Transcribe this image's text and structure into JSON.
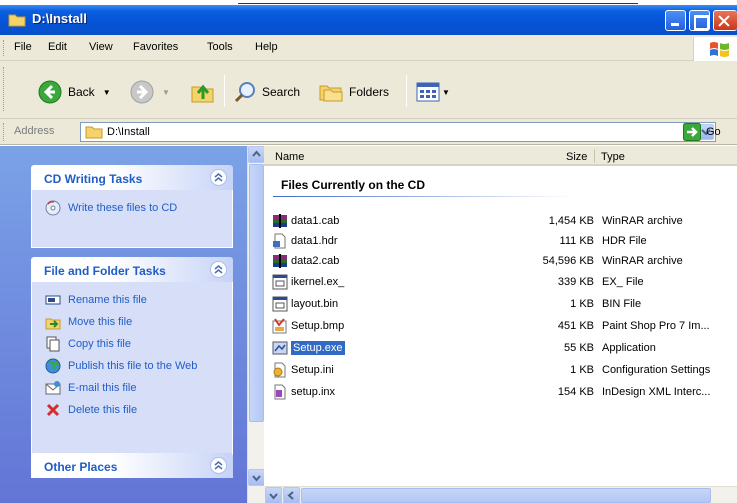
{
  "window": {
    "title": "D:\\Install"
  },
  "menu": [
    "File",
    "Edit",
    "View",
    "Favorites",
    "Tools",
    "Help"
  ],
  "toolbar": {
    "back_label": "Back",
    "search_label": "Search",
    "folders_label": "Folders"
  },
  "address": {
    "label": "Address",
    "value": "D:\\Install",
    "go_label": "Go"
  },
  "tasks": {
    "cd": {
      "title": "CD Writing Tasks",
      "items": [
        "Write these files to CD"
      ]
    },
    "file": {
      "title": "File and Folder Tasks",
      "items": [
        "Rename this file",
        "Move this file",
        "Copy this file",
        "Publish this file to the Web",
        "E-mail this file",
        "Delete this file"
      ]
    },
    "other": {
      "title": "Other Places"
    }
  },
  "columns": {
    "name": "Name",
    "size": "Size",
    "type": "Type"
  },
  "group_title": "Files Currently on the CD",
  "files": [
    {
      "name": "data1.cab",
      "size": "1,454 KB",
      "type": "WinRAR archive",
      "icon": "winrar-icon"
    },
    {
      "name": "data1.hdr",
      "size": "111 KB",
      "type": "HDR File",
      "icon": "generic-file-icon"
    },
    {
      "name": "data2.cab",
      "size": "54,596 KB",
      "type": "WinRAR archive",
      "icon": "winrar-icon"
    },
    {
      "name": "ikernel.ex_",
      "size": "339 KB",
      "type": "EX_ File",
      "icon": "window-file-icon"
    },
    {
      "name": "layout.bin",
      "size": "1 KB",
      "type": "BIN File",
      "icon": "window-file-icon"
    },
    {
      "name": "Setup.bmp",
      "size": "451 KB",
      "type": "Paint Shop Pro 7 Im...",
      "icon": "image-file-icon"
    },
    {
      "name": "Setup.exe",
      "size": "55 KB",
      "type": "Application",
      "icon": "app-icon"
    },
    {
      "name": "Setup.ini",
      "size": "1 KB",
      "type": "Configuration Settings",
      "icon": "settings-file-icon"
    },
    {
      "name": "setup.inx",
      "size": "154 KB",
      "type": "InDesign XML Interc...",
      "icon": "inx-file-icon"
    }
  ]
}
